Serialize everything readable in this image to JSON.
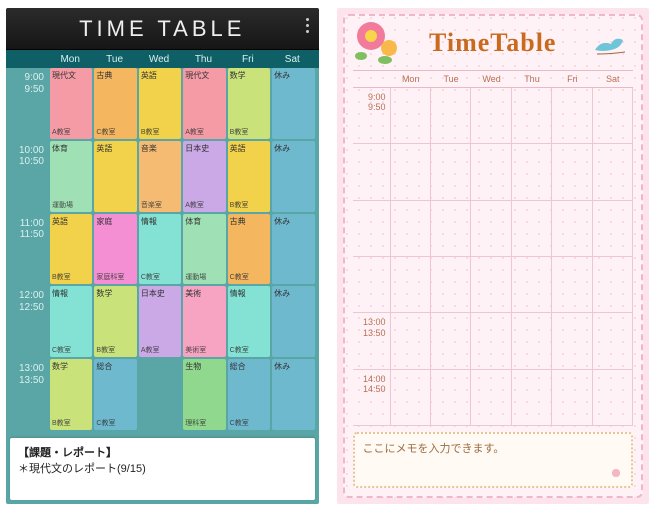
{
  "left": {
    "title": "TIME TABLE",
    "days": [
      "Mon",
      "Tue",
      "Wed",
      "Thu",
      "Fri",
      "Sat"
    ],
    "periods": [
      {
        "start": "9:00",
        "end": "9:50"
      },
      {
        "start": "10:00",
        "end": "10:50"
      },
      {
        "start": "11:00",
        "end": "11:50"
      },
      {
        "start": "12:00",
        "end": "12:50"
      },
      {
        "start": "13:00",
        "end": "13:50"
      }
    ],
    "cells": [
      [
        {
          "subject": "現代文",
          "room": "A教室",
          "color": "#f59ba6"
        },
        {
          "subject": "古典",
          "room": "C教室",
          "color": "#f4b65e"
        },
        {
          "subject": "英語",
          "room": "B教室",
          "color": "#f2d24a"
        },
        {
          "subject": "現代文",
          "room": "A教室",
          "color": "#f59ba6"
        },
        {
          "subject": "数学",
          "room": "B教室",
          "color": "#c9e27a"
        },
        {
          "subject": "休み",
          "room": "",
          "color": "#6fb9cf"
        }
      ],
      [
        {
          "subject": "体育",
          "room": "運動場",
          "color": "#9fe1b4"
        },
        {
          "subject": "英語",
          "room": "",
          "color": "#f2d24a"
        },
        {
          "subject": "音楽",
          "room": "音楽室",
          "color": "#f5bb73"
        },
        {
          "subject": "日本史",
          "room": "A教室",
          "color": "#cba8e6"
        },
        {
          "subject": "英語",
          "room": "B教室",
          "color": "#f2d24a"
        },
        {
          "subject": "休み",
          "room": "",
          "color": "#6fb9cf"
        }
      ],
      [
        {
          "subject": "英語",
          "room": "B教室",
          "color": "#f2d24a"
        },
        {
          "subject": "家庭",
          "room": "家庭科室",
          "color": "#f48fd4"
        },
        {
          "subject": "情報",
          "room": "C教室",
          "color": "#84e2d4"
        },
        {
          "subject": "体育",
          "room": "運動場",
          "color": "#9fe1b4"
        },
        {
          "subject": "古典",
          "room": "C教室",
          "color": "#f4b65e"
        },
        {
          "subject": "休み",
          "room": "",
          "color": "#6fb9cf"
        }
      ],
      [
        {
          "subject": "情報",
          "room": "C教室",
          "color": "#84e2d4"
        },
        {
          "subject": "数学",
          "room": "B教室",
          "color": "#c9e27a"
        },
        {
          "subject": "日本史",
          "room": "A教室",
          "color": "#cba8e6"
        },
        {
          "subject": "美術",
          "room": "美術室",
          "color": "#f7a4c2"
        },
        {
          "subject": "情報",
          "room": "C教室",
          "color": "#84e2d4"
        },
        {
          "subject": "休み",
          "room": "",
          "color": "#6fb9cf"
        }
      ],
      [
        {
          "subject": "数学",
          "room": "B教室",
          "color": "#c9e27a"
        },
        {
          "subject": "総合",
          "room": "C教室",
          "color": "#6fb9cf"
        },
        {
          "subject": "",
          "room": "",
          "color": ""
        },
        {
          "subject": "生物",
          "room": "理科室",
          "color": "#8fd88d"
        },
        {
          "subject": "総合",
          "room": "C教室",
          "color": "#6fb9cf"
        },
        {
          "subject": "休み",
          "room": "",
          "color": "#6fb9cf"
        }
      ]
    ],
    "memo": {
      "title": "【課題・レポート】",
      "line": "＊現代文のレポート(9/15)"
    }
  },
  "right": {
    "title": "TimeTable",
    "days": [
      "Mon",
      "Tue",
      "Wed",
      "Thu",
      "Fri",
      "Sat"
    ],
    "periods": [
      {
        "start": "9:00",
        "end": "9:50"
      },
      {
        "start": "",
        "end": ""
      },
      {
        "start": "",
        "end": ""
      },
      {
        "start": "",
        "end": ""
      },
      {
        "start": "13:00",
        "end": "13:50"
      },
      {
        "start": "14:00",
        "end": "14:50"
      }
    ],
    "memo": "ここにメモを入力できます。"
  }
}
